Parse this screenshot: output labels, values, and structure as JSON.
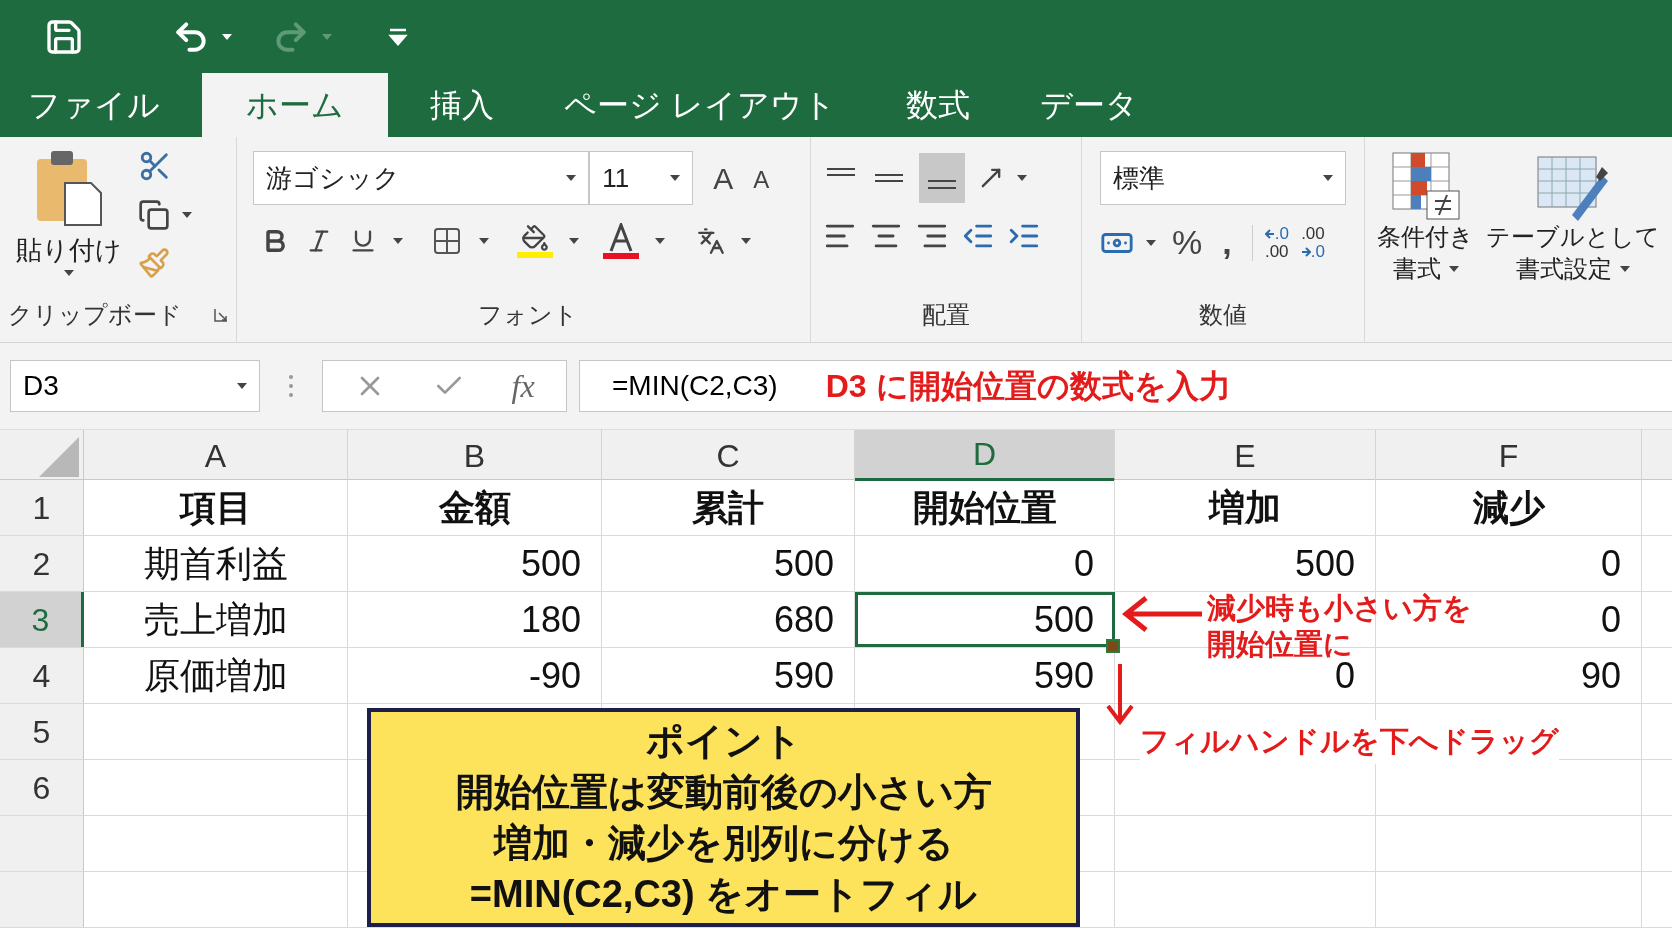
{
  "quick_access": {
    "redo_disabled": true
  },
  "tabs": [
    {
      "label": "ファイル",
      "selected": false
    },
    {
      "label": "ホーム",
      "selected": true
    },
    {
      "label": "挿入",
      "selected": false
    },
    {
      "label": "ページ レイアウト",
      "selected": false
    },
    {
      "label": "数式",
      "selected": false
    },
    {
      "label": "データ",
      "selected": false
    }
  ],
  "ribbon": {
    "clipboard": {
      "paste": "貼り付け",
      "label": "クリップボード"
    },
    "font": {
      "font_name": "游ゴシック",
      "font_size": "11",
      "grow": "A",
      "shrink": "A",
      "label": "フォント"
    },
    "alignment": {
      "label": "配置"
    },
    "number": {
      "format": "標準",
      "percent": "%",
      "comma": ",",
      "increase_decimal": [
        ".0",
        ".00"
      ],
      "decrease_decimal": [
        ".00",
        ".0"
      ],
      "label": "数値"
    },
    "styles": [
      {
        "lines": [
          "条件付き",
          "書式"
        ]
      },
      {
        "lines": [
          "テーブルとして",
          "書式設定"
        ]
      }
    ]
  },
  "formula_bar": {
    "name_box": "D3",
    "fx": "fx",
    "formula": "=MIN(C2,C3)",
    "note": "D3 に開始位置の数式を入力"
  },
  "sheet": {
    "columns": [
      {
        "label": "A",
        "selected": false
      },
      {
        "label": "B",
        "selected": false
      },
      {
        "label": "C",
        "selected": false
      },
      {
        "label": "D",
        "selected": true
      },
      {
        "label": "E",
        "selected": false
      },
      {
        "label": "F",
        "selected": false
      }
    ],
    "rows": [
      {
        "number": "1",
        "selected": false,
        "cells": [
          {
            "text": "項目",
            "kind": "header",
            "active": false
          },
          {
            "text": "金額",
            "kind": "header",
            "active": false
          },
          {
            "text": "累計",
            "kind": "header",
            "active": false
          },
          {
            "text": "開始位置",
            "kind": "header",
            "active": false
          },
          {
            "text": "増加",
            "kind": "header",
            "active": false
          },
          {
            "text": "減少",
            "kind": "header",
            "active": false
          }
        ]
      },
      {
        "number": "2",
        "selected": false,
        "cells": [
          {
            "text": "期首利益",
            "kind": "label",
            "active": false
          },
          {
            "text": "500",
            "kind": "number",
            "active": false
          },
          {
            "text": "500",
            "kind": "number",
            "active": false
          },
          {
            "text": "0",
            "kind": "number",
            "active": false
          },
          {
            "text": "500",
            "kind": "number",
            "active": false
          },
          {
            "text": "0",
            "kind": "number",
            "active": false
          }
        ]
      },
      {
        "number": "3",
        "selected": true,
        "cells": [
          {
            "text": "売上増加",
            "kind": "label",
            "active": false
          },
          {
            "text": "180",
            "kind": "number",
            "active": false
          },
          {
            "text": "680",
            "kind": "number",
            "active": false
          },
          {
            "text": "500",
            "kind": "number",
            "active": true
          },
          {
            "text": "",
            "kind": "empty",
            "active": false
          },
          {
            "text": "0",
            "kind": "number",
            "active": false
          }
        ]
      },
      {
        "number": "4",
        "selected": false,
        "cells": [
          {
            "text": "原価増加",
            "kind": "label",
            "active": false
          },
          {
            "text": "-90",
            "kind": "number",
            "active": false
          },
          {
            "text": "590",
            "kind": "number",
            "active": false
          },
          {
            "text": "590",
            "kind": "number",
            "active": false
          },
          {
            "text": "0",
            "kind": "number",
            "active": false
          },
          {
            "text": "90",
            "kind": "number",
            "active": false
          }
        ]
      },
      {
        "number": "5",
        "selected": false,
        "cells": []
      },
      {
        "number": "6",
        "selected": false,
        "cells": []
      }
    ]
  },
  "callout": {
    "lines": [
      "ポイント",
      "開始位置は変動前後の小さい方",
      "増加・減少を別列に分ける",
      "=MIN(C2,C3) をオートフィル"
    ]
  },
  "annotations": {
    "side_note": [
      "減少時も小さい方を",
      "開始位置に"
    ],
    "drag_note": "フィルハンドルを下へドラッグ"
  }
}
